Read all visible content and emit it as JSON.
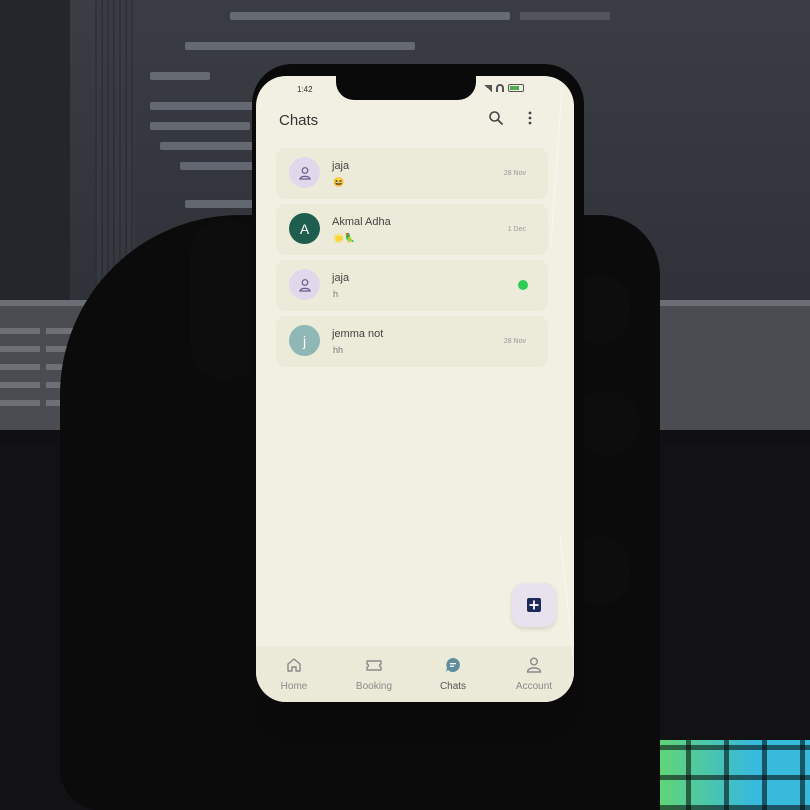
{
  "status_bar": {
    "time": "1:42"
  },
  "app_bar": {
    "title": "Chats"
  },
  "chats": [
    {
      "name": "jaja",
      "message": "😆",
      "date": "28 Nov",
      "avatar": "person-icon",
      "avatar_letter": "",
      "avatar_color": "#e2d8ec"
    },
    {
      "name": "Akmal Adha",
      "message": "🌟🦜",
      "date": "1 Dec",
      "avatar": "letter",
      "avatar_letter": "A",
      "avatar_color": "#1f5d4f"
    },
    {
      "name": "jaja",
      "message": "h",
      "date": "",
      "avatar": "person-icon",
      "avatar_letter": "",
      "avatar_color": "#e2d8ec",
      "online": true
    },
    {
      "name": "jemma not",
      "message": "hh",
      "date": "28 Nov",
      "avatar": "letter",
      "avatar_letter": "j",
      "avatar_color": "#8fb7b5"
    }
  ],
  "bottom_nav": {
    "active": "Chats",
    "items": [
      {
        "label": "Home",
        "icon": "home-icon"
      },
      {
        "label": "Booking",
        "icon": "ticket-icon"
      },
      {
        "label": "Chats",
        "icon": "chat-bubble-icon"
      },
      {
        "label": "Account",
        "icon": "account-icon"
      }
    ]
  },
  "colors": {
    "screen_bg": "#f1f0e2",
    "card_bg": "#ecebd9",
    "online": "#2ecc55",
    "fab_bg": "#e8e2ee",
    "fab_icon": "#1c2a5a"
  }
}
